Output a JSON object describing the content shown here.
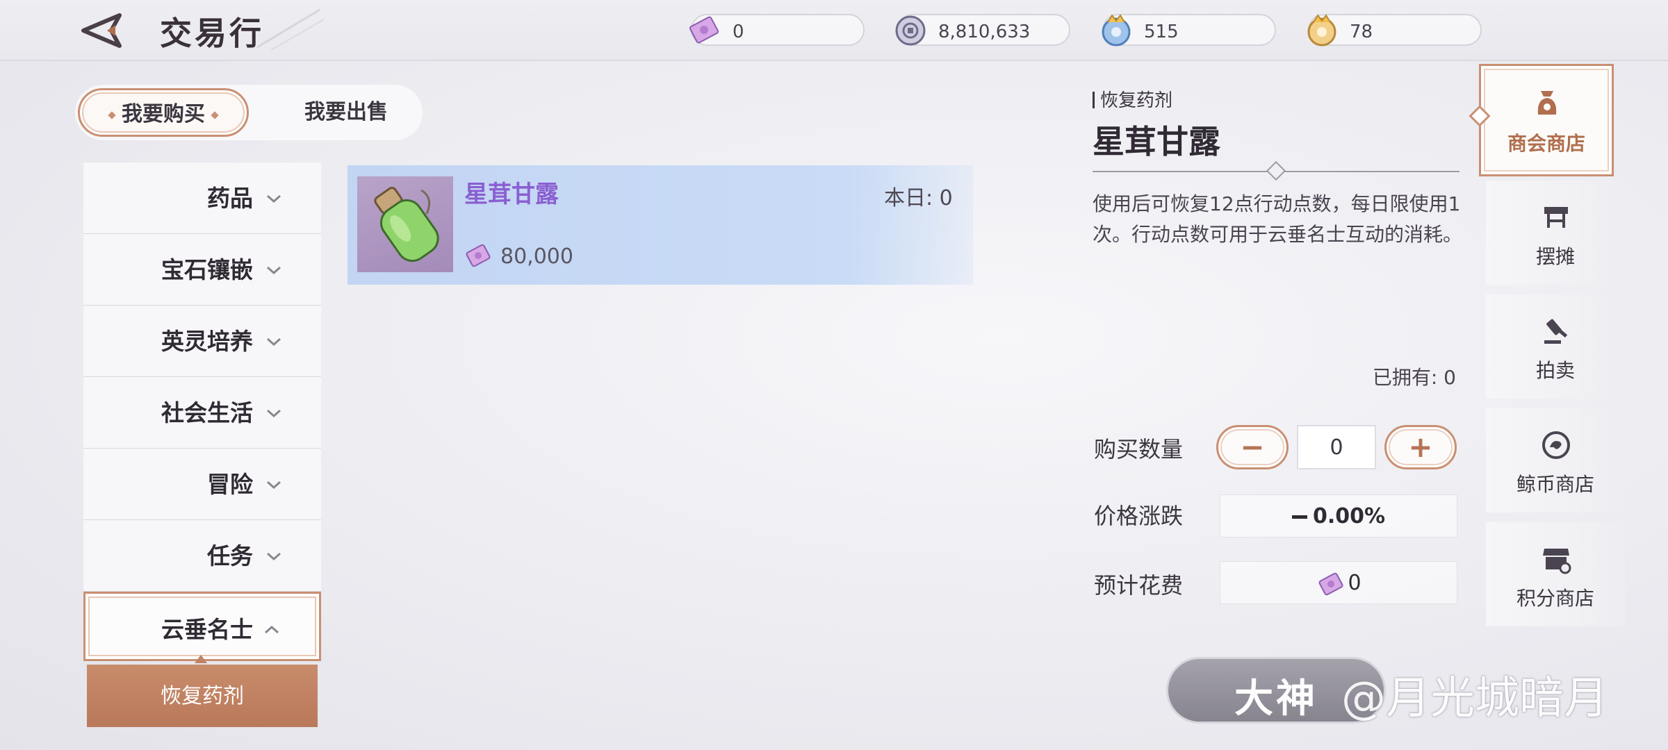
{
  "header": {
    "title": "交易行",
    "currencies": [
      {
        "icon": "voucher-icon",
        "value": "0"
      },
      {
        "icon": "silver-coin-icon",
        "value": "8,810,633"
      },
      {
        "icon": "blue-coin-icon",
        "value": "515"
      },
      {
        "icon": "gold-coin-icon",
        "value": "78"
      }
    ]
  },
  "mode_tabs": {
    "buy": "我要购买",
    "sell": "我要出售",
    "selected": "buy"
  },
  "categories": [
    {
      "label": "药品",
      "expanded": false
    },
    {
      "label": "宝石镶嵌",
      "expanded": false
    },
    {
      "label": "英灵培养",
      "expanded": false
    },
    {
      "label": "社会生活",
      "expanded": false
    },
    {
      "label": "冒险",
      "expanded": false
    },
    {
      "label": "任务",
      "expanded": false
    },
    {
      "label": "云垂名士",
      "expanded": true
    }
  ],
  "subcategory": {
    "label": "恢复药剂",
    "selected": true
  },
  "items": [
    {
      "name": "星茸甘露",
      "daily": "本日: 0",
      "price": "80,000",
      "icon": "potion-bottle-icon"
    }
  ],
  "detail": {
    "category": "恢复药剂",
    "name": "星茸甘露",
    "description": "使用后可恢复12点行动点数，每日限使用1次。行动点数可用于云垂名士互动的消耗。",
    "owned": "已拥有: 0",
    "qty_label": "购买数量",
    "qty_value": "0",
    "price_change_label": "价格涨跌",
    "price_change_value": "0.00%",
    "cost_label": "预计花费",
    "cost_value": "0"
  },
  "right_nav": [
    {
      "label": "商会商店",
      "icon": "money-bag-icon",
      "active": true
    },
    {
      "label": "摆摊",
      "icon": "stall-icon",
      "active": false
    },
    {
      "label": "拍卖",
      "icon": "gavel-icon",
      "active": false
    },
    {
      "label": "鲸币商店",
      "icon": "whale-coin-icon",
      "active": false
    },
    {
      "label": "积分商店",
      "icon": "points-shop-icon",
      "active": false
    }
  ],
  "watermark": {
    "badge": "大神",
    "text": "@月光城暗月"
  },
  "colors": {
    "accent": "#c98f72",
    "selected_row": "#c6d8f4",
    "item_name": "#8a5fd1",
    "subcategory_bg": "#bf8262"
  }
}
